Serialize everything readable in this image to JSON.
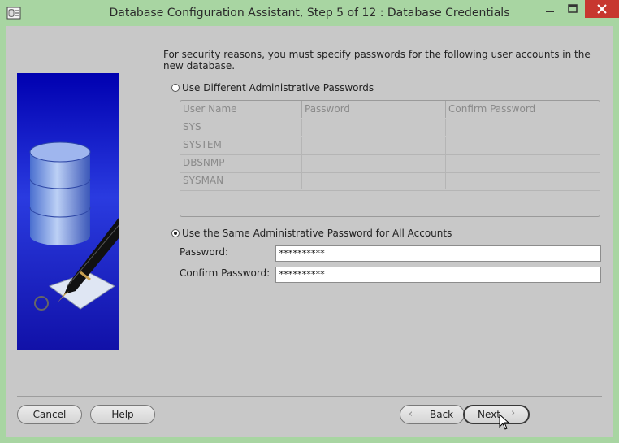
{
  "window": {
    "title": "Database Configuration Assistant, Step 5 of 12 : Database Credentials"
  },
  "intro": "For security reasons, you must specify passwords for the following user accounts in the new database.",
  "options": {
    "different": {
      "label": "Use Different Administrative Passwords",
      "selected": false
    },
    "same": {
      "label": "Use the Same Administrative Password for All Accounts",
      "selected": true
    }
  },
  "table": {
    "columns": [
      "User Name",
      "Password",
      "Confirm Password"
    ],
    "rows": [
      [
        "SYS",
        "",
        ""
      ],
      [
        "SYSTEM",
        "",
        ""
      ],
      [
        "DBSNMP",
        "",
        ""
      ],
      [
        "SYSMAN",
        "",
        ""
      ]
    ]
  },
  "form": {
    "password_label": "Password:",
    "password_value": "**********",
    "confirm_label": "Confirm Password:",
    "confirm_value": "**********"
  },
  "buttons": {
    "cancel": "Cancel",
    "help": "Help",
    "back": "Back",
    "next": "Next"
  },
  "colors": {
    "title_bar": "#a8d5a2",
    "close_button": "#c7372f",
    "dialog_bg": "#c8c8c8",
    "banner_blue": "#1e1ec8"
  },
  "icons": [
    "app-icon",
    "minimize-icon",
    "maximize-icon",
    "close-icon",
    "database-cylinder-icon",
    "pen-icon",
    "chevron-left-icon",
    "chevron-right-icon",
    "mouse-cursor-icon"
  ]
}
